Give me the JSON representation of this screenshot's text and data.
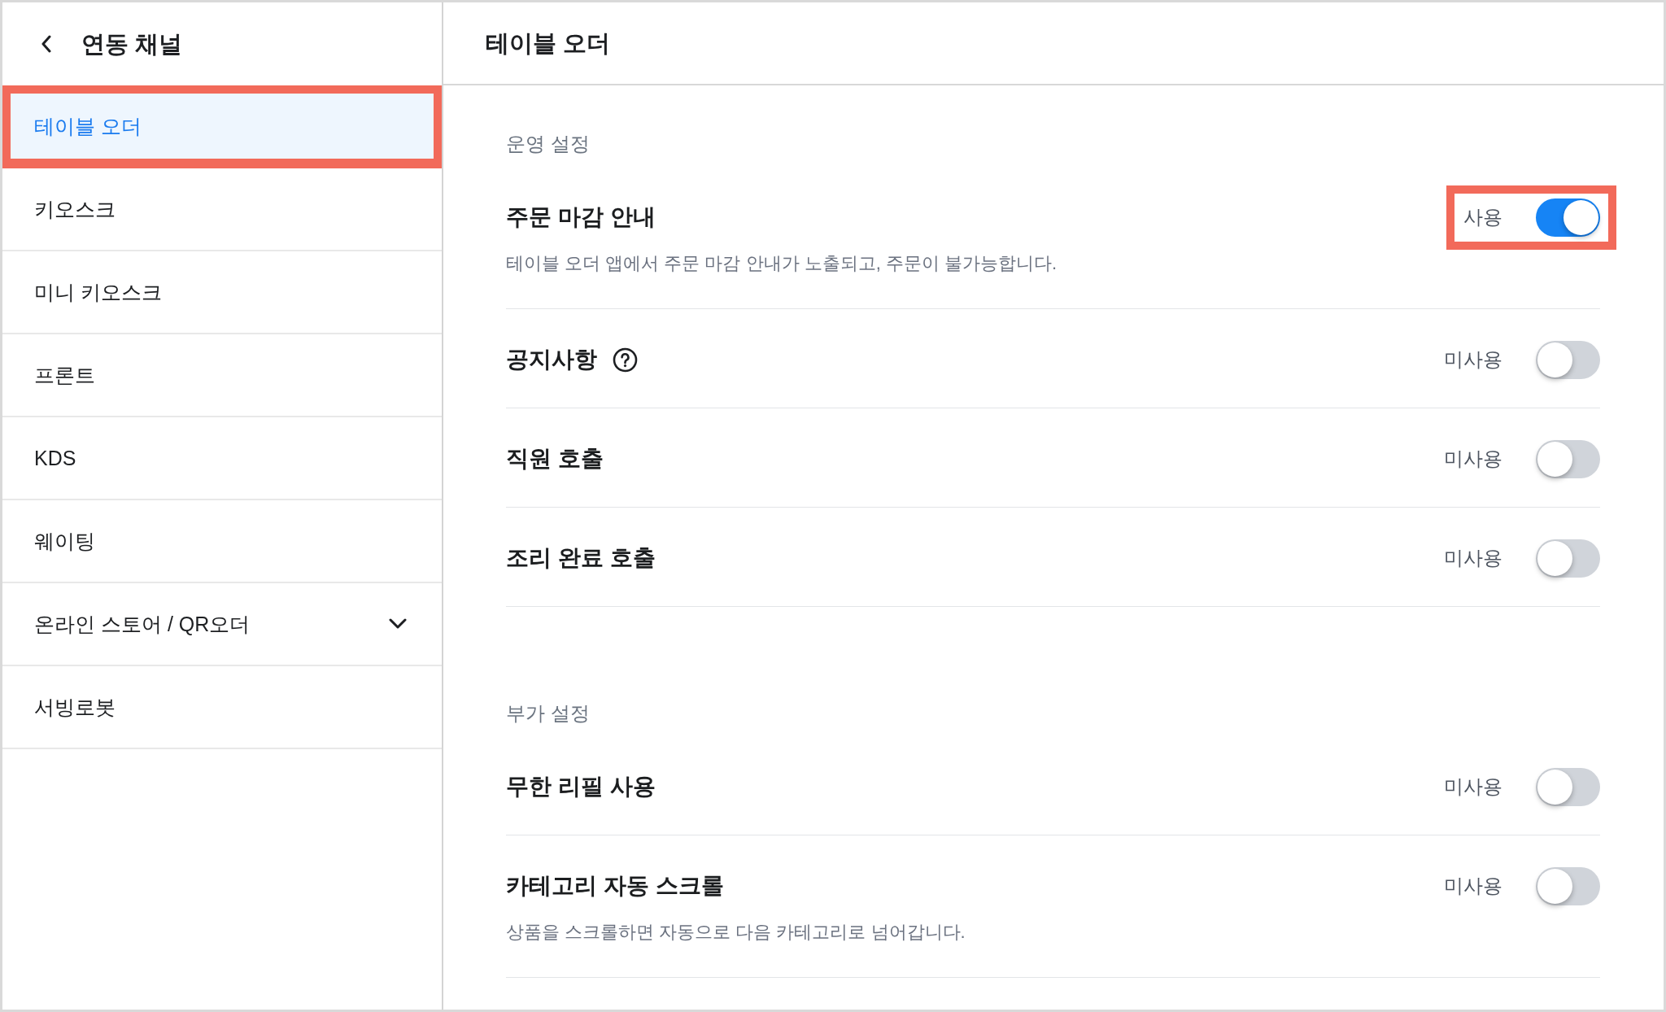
{
  "sidebar": {
    "title": "연동 채널",
    "items": [
      {
        "label": "테이블 오더",
        "kind": "link",
        "selected": true,
        "highlighted": true
      },
      {
        "label": "키오스크",
        "kind": "link",
        "selected": false,
        "highlighted": false
      },
      {
        "label": "미니 키오스크",
        "kind": "link",
        "selected": false,
        "highlighted": false
      },
      {
        "label": "프론트",
        "kind": "link",
        "selected": false,
        "highlighted": false
      },
      {
        "label": "KDS",
        "kind": "link",
        "selected": false,
        "highlighted": false
      },
      {
        "label": "웨이팅",
        "kind": "link",
        "selected": false,
        "highlighted": false
      },
      {
        "label": "온라인 스토어 / QR오더",
        "kind": "group",
        "expanded": false,
        "selected": false,
        "highlighted": false
      },
      {
        "label": "서빙로봇",
        "kind": "link",
        "selected": false,
        "highlighted": false
      }
    ]
  },
  "main": {
    "title": "테이블 오더",
    "sections": [
      {
        "title": "운영 설정",
        "settings": [
          {
            "label": "주문 마감 안내",
            "help": false,
            "description": "테이블 오더 앱에서 주문 마감 안내가 노출되고, 주문이 불가능합니다.",
            "status": "사용",
            "on": true,
            "highlighted": true
          },
          {
            "label": "공지사항",
            "help": true,
            "status": "미사용",
            "on": false,
            "highlighted": false
          },
          {
            "label": "직원 호출",
            "help": false,
            "status": "미사용",
            "on": false,
            "highlighted": false
          },
          {
            "label": "조리 완료 호출",
            "help": false,
            "status": "미사용",
            "on": false,
            "highlighted": false
          }
        ]
      },
      {
        "title": "부가 설정",
        "settings": [
          {
            "label": "무한 리필 사용",
            "help": false,
            "status": "미사용",
            "on": false,
            "highlighted": false
          },
          {
            "label": "카테고리 자동 스크롤",
            "help": false,
            "description": "상품을 스크롤하면 자동으로 다음 카테고리로 넘어갑니다.",
            "status": "미사용",
            "on": false,
            "highlighted": false
          }
        ]
      }
    ]
  }
}
